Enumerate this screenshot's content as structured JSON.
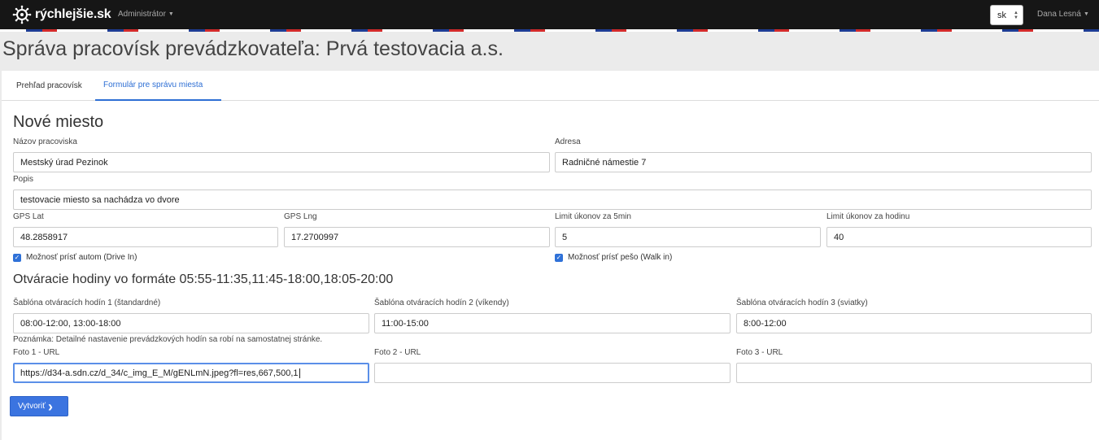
{
  "navbar": {
    "brand": "rýchlejšie.sk",
    "admin_menu": "Administrátor",
    "language": "sk",
    "user_menu": "Dana Lesná"
  },
  "page": {
    "title": "Správa pracovísk prevádzkovateľa: Prvá testovacia a.s."
  },
  "tabs": [
    {
      "label": "Prehľad pracovísk",
      "active": false
    },
    {
      "label": "Formulár pre správu miesta",
      "active": true
    }
  ],
  "form": {
    "title": "Nové miesto",
    "name": {
      "label": "Názov pracoviska",
      "value": "Mestský úrad Pezinok"
    },
    "address": {
      "label": "Adresa",
      "value": "Radničné námestie 7"
    },
    "description": {
      "label": "Popis",
      "value": "testovacie miesto sa nachádza vo dvore"
    },
    "gps_lat": {
      "label": "GPS Lat",
      "value": "48.2858917"
    },
    "gps_lng": {
      "label": "GPS Lng",
      "value": "17.2700997"
    },
    "limit_5min": {
      "label": "Limit úkonov za 5min",
      "value": "5"
    },
    "limit_hour": {
      "label": "Limit úkonov za hodinu",
      "value": "40"
    },
    "drive_in": {
      "label": "Možnosť prísť autom (Drive In)",
      "checked": true
    },
    "walk_in": {
      "label": "Možnosť prísť pešo (Walk in)",
      "checked": true
    },
    "hours_title": "Otváracie hodiny vo formáte 05:55-11:35,11:45-18:00,18:05-20:00",
    "template1": {
      "label": "Šablóna otváracích hodín 1 (štandardné)",
      "value": "08:00-12:00, 13:00-18:00"
    },
    "template2": {
      "label": "Šablóna otváracích hodín 2 (víkendy)",
      "value": "11:00-15:00"
    },
    "template3": {
      "label": "Šablóna otváracích hodín 3 (sviatky)",
      "value": "8:00-12:00"
    },
    "note": "Poznámka: Detailné nastavenie prevádzkových hodín sa robí na samostatnej stránke.",
    "photo1": {
      "label": "Foto 1 - URL",
      "value": "https://d34-a.sdn.cz/d_34/c_img_E_M/gENLmN.jpeg?fl=res,667,500,1"
    },
    "photo2": {
      "label": "Foto 2 - URL",
      "value": ""
    },
    "photo3": {
      "label": "Foto 3 - URL",
      "value": ""
    },
    "submit": "Vytvoriť"
  },
  "colors": {
    "navbar": "#161616",
    "accent": "#2e6fd4",
    "button": "#3b74e0",
    "stripe_blue": "#1d3c94",
    "stripe_red": "#d32a2a"
  }
}
